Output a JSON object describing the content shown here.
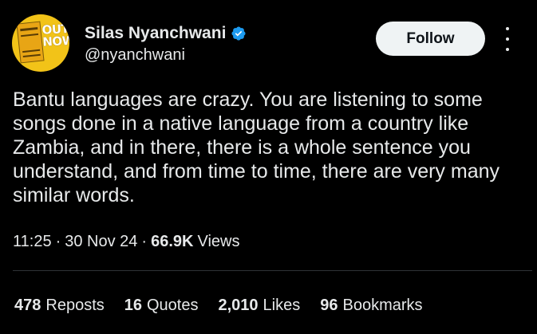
{
  "author": {
    "display_name": "Silas Nyanchwani",
    "handle": "@nyanchwani",
    "verified": true,
    "avatar_text": "OUT NOW"
  },
  "actions": {
    "follow_label": "Follow",
    "more_icon": "more-horizontal-icon"
  },
  "tweet": {
    "text": "Bantu languages are crazy. You are listening to some songs done in a native language from a country like Zambia, and in there, there is a whole sentence you understand, and from time to time, there are very many similar words."
  },
  "meta": {
    "time": "11:25",
    "date": "30 Nov 24",
    "separator": "·",
    "views_count": "66.9K",
    "views_label": "Views"
  },
  "stats": [
    {
      "count": "478",
      "label": "Reposts"
    },
    {
      "count": "16",
      "label": "Quotes"
    },
    {
      "count": "2,010",
      "label": "Likes"
    },
    {
      "count": "96",
      "label": "Bookmarks"
    }
  ],
  "colors": {
    "background": "#000000",
    "text": "#e7e9ea",
    "verified_blue": "#1d9bf0",
    "follow_bg": "#eff3f4",
    "divider": "#2f3336",
    "avatar_bg": "#f2c318"
  }
}
